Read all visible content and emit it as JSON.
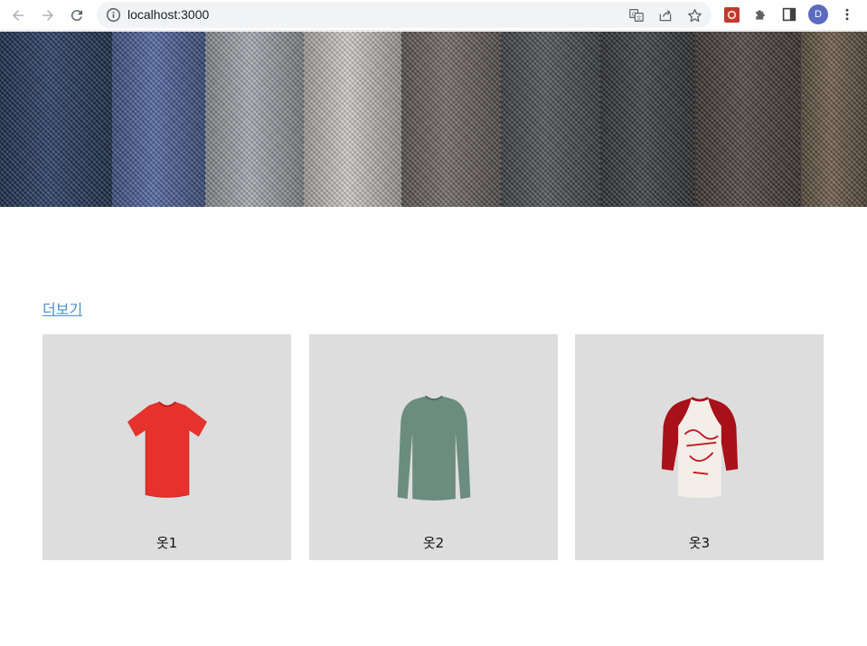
{
  "browser": {
    "url": "localhost:3000",
    "profile_initial": "D",
    "icons": [
      "back-icon",
      "forward-icon",
      "reload-icon",
      "info-icon",
      "translate-icon",
      "share-icon",
      "bookmark-star-icon",
      "extension-app-icon",
      "puzzle-extensions-icon",
      "side-panel-icon",
      "menu-dots-icon"
    ]
  },
  "hero": {
    "swatch_colors": [
      "#23385f",
      "#4e64a0",
      "#a8aab0",
      "#cfccc8",
      "#6e6766",
      "#4e4f53",
      "#3a3b3f",
      "#4c4140",
      "#6b5a48"
    ]
  },
  "main": {
    "more_link": "더보기",
    "products": [
      {
        "name": "옷1",
        "image": "red-tshirt",
        "color": "#e5322c"
      },
      {
        "name": "옷2",
        "image": "green-longsleeve",
        "color": "#6b8c7f"
      },
      {
        "name": "옷3",
        "image": "raglan-tshirt",
        "color": "#a8101a"
      }
    ]
  },
  "colors": {
    "link": "#4a8fd6",
    "card_bg": "#dddddd",
    "avatar": "#5c6bc0"
  }
}
